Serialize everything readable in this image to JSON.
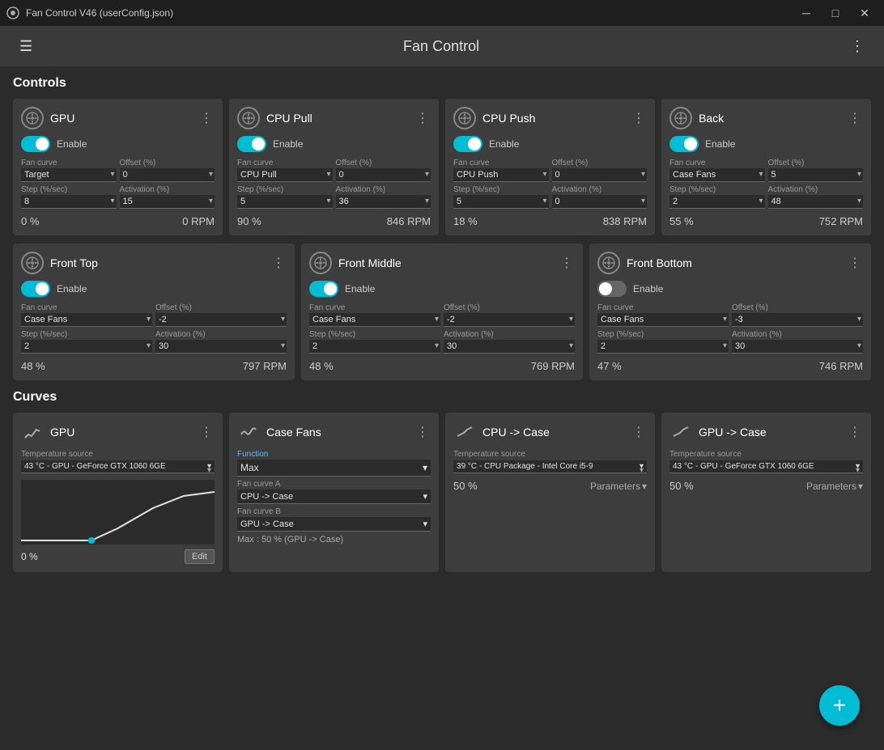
{
  "titlebar": {
    "title": "Fan Control V46 (userConfig.json)",
    "minimize": "─",
    "maximize": "□",
    "close": "✕"
  },
  "header": {
    "title": "Fan Control",
    "hamburger": "☰",
    "dots": "⋮"
  },
  "sections": {
    "controls": "Controls",
    "curves": "Curves"
  },
  "controls": [
    {
      "title": "GPU",
      "enabled": true,
      "fan_curve_label": "Fan curve",
      "fan_curve": "Target",
      "offset_label": "Offset (%)",
      "offset": "0",
      "step_label": "Step (%/sec)",
      "step": "8",
      "activation_label": "Activation (%)",
      "activation": "15",
      "pct": "0 %",
      "rpm": "0 RPM"
    },
    {
      "title": "CPU Pull",
      "enabled": true,
      "fan_curve_label": "Fan curve",
      "fan_curve": "CPU Pull",
      "offset_label": "Offset (%)",
      "offset": "0",
      "step_label": "Step (%/sec)",
      "step": "5",
      "activation_label": "Activation (%)",
      "activation": "36",
      "pct": "90 %",
      "rpm": "846 RPM"
    },
    {
      "title": "CPU Push",
      "enabled": true,
      "fan_curve_label": "Fan curve",
      "fan_curve": "CPU Push",
      "offset_label": "Offset (%)",
      "offset": "0",
      "step_label": "Step (%/sec)",
      "step": "5",
      "activation_label": "Activation (%)",
      "activation": "0",
      "pct": "18 %",
      "rpm": "838 RPM"
    },
    {
      "title": "Back",
      "enabled": true,
      "fan_curve_label": "Fan curve",
      "fan_curve": "Case Fans",
      "offset_label": "Offset (%)",
      "offset": "5",
      "step_label": "Step (%/sec)",
      "step": "2",
      "activation_label": "Activation (%)",
      "activation": "48",
      "pct": "55 %",
      "rpm": "752 RPM"
    },
    {
      "title": "Front Top",
      "enabled": true,
      "fan_curve_label": "Fan curve",
      "fan_curve": "Case Fans",
      "offset_label": "Offset (%)",
      "offset": "-2",
      "step_label": "Step (%/sec)",
      "step": "2",
      "activation_label": "Activation (%)",
      "activation": "30",
      "pct": "48 %",
      "rpm": "797 RPM"
    },
    {
      "title": "Front Middle",
      "enabled": true,
      "fan_curve_label": "Fan curve",
      "fan_curve": "Case Fans",
      "offset_label": "Offset (%)",
      "offset": "-2",
      "step_label": "Step (%/sec)",
      "step": "2",
      "activation_label": "Activation (%)",
      "activation": "30",
      "pct": "48 %",
      "rpm": "769 RPM"
    },
    {
      "title": "Front Bottom",
      "enabled": true,
      "fan_curve_label": "Fan curve",
      "fan_curve": "Case Fans",
      "offset_label": "Offset (%)",
      "offset": "-3",
      "step_label": "Step (%/sec)",
      "step": "2",
      "activation_label": "Activation (%)",
      "activation": "30",
      "pct": "47 %",
      "rpm": "746 RPM"
    }
  ],
  "curves": [
    {
      "title": "GPU",
      "icon": "line",
      "temp_label": "Temperature source",
      "temp_value": "43 °C - GPU - GeForce GTX 1060 6GE",
      "has_chart": true,
      "chart_pct": "0 %",
      "edit_label": "Edit"
    },
    {
      "title": "Case Fans",
      "icon": "wave",
      "function_label": "Function",
      "function_value": "Max",
      "fan_curve_a_label": "Fan curve A",
      "fan_curve_a": "CPU -> Case",
      "fan_curve_b_label": "Fan curve B",
      "fan_curve_b": "GPU -> Case",
      "max_info": "Max : 50 % (GPU -> Case)"
    },
    {
      "title": "CPU -> Case",
      "icon": "line2",
      "temp_label": "Temperature source",
      "temp_value": "39 °C - CPU Package - Intel Core i5-9",
      "pct": "50 %",
      "params_label": "Parameters"
    },
    {
      "title": "GPU -> Case",
      "icon": "line2",
      "temp_label": "Temperature source",
      "temp_value": "43 °C - GPU - GeForce GTX 1060 6GE",
      "pct": "50 %",
      "params_label": "Parameters"
    }
  ],
  "fab_label": "+"
}
